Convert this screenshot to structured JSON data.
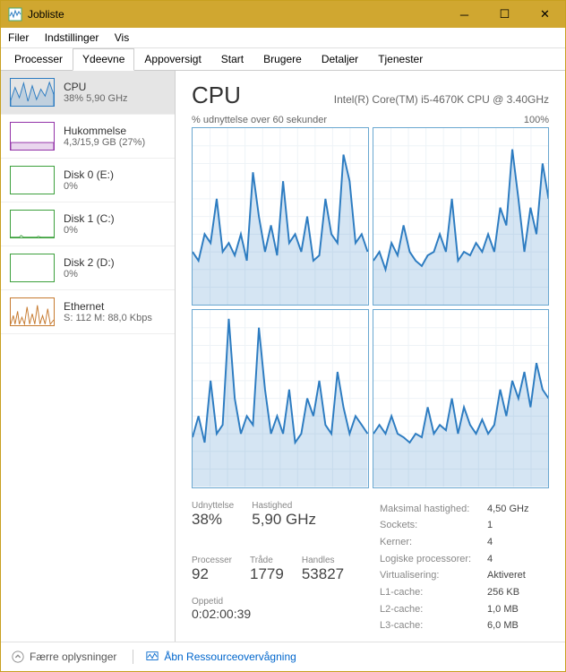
{
  "window": {
    "title": "Jobliste"
  },
  "menu": {
    "file": "Filer",
    "settings": "Indstillinger",
    "view": "Vis"
  },
  "tabs": [
    "Processer",
    "Ydeevne",
    "Appoversigt",
    "Start",
    "Brugere",
    "Detaljer",
    "Tjenester"
  ],
  "activeTab": 1,
  "sidebar": [
    {
      "name": "CPU",
      "sub": "38%  5,90 GHz",
      "color": "#2d7cc1"
    },
    {
      "name": "Hukommelse",
      "sub": "4,3/15,9 GB (27%)",
      "color": "#9333a8"
    },
    {
      "name": "Disk 0 (E:)",
      "sub": "0%",
      "color": "#3ca03c"
    },
    {
      "name": "Disk 1 (C:)",
      "sub": "0%",
      "color": "#3ca03c"
    },
    {
      "name": "Disk 2 (D:)",
      "sub": "0%",
      "color": "#3ca03c"
    },
    {
      "name": "Ethernet",
      "sub": "S: 112 M: 88,0 Kbps",
      "color": "#c67a2f"
    }
  ],
  "selectedSidebar": 0,
  "main": {
    "title": "CPU",
    "model": "Intel(R) Core(TM) i5-4670K CPU @ 3.40GHz",
    "chartLabelLeft": "% udnyttelse over 60 sekunder",
    "chartLabelRight": "100%"
  },
  "stats": {
    "utilLabel": "Udnyttelse",
    "util": "38%",
    "speedLabel": "Hastighed",
    "speed": "5,90 GHz",
    "procLabel": "Processer",
    "proc": "92",
    "threadsLabel": "Tråde",
    "threads": "1779",
    "handlesLabel": "Handles",
    "handles": "53827",
    "uptimeLabel": "Oppetid",
    "uptime": "0:02:00:39"
  },
  "right": [
    {
      "k": "Maksimal hastighed:",
      "v": "4,50 GHz"
    },
    {
      "k": "Sockets:",
      "v": "1"
    },
    {
      "k": "Kerner:",
      "v": "4"
    },
    {
      "k": "Logiske processorer:",
      "v": "4"
    },
    {
      "k": "Virtualisering:",
      "v": "Aktiveret"
    },
    {
      "k": "L1-cache:",
      "v": "256 KB"
    },
    {
      "k": "L2-cache:",
      "v": "1,0 MB"
    },
    {
      "k": "L3-cache:",
      "v": "6,0 MB"
    }
  ],
  "footer": {
    "fewer": "Færre oplysninger",
    "resmon": "Åbn Ressourceovervågning"
  },
  "chart_data": {
    "type": "line",
    "cores": 4,
    "x_seconds": 60,
    "ylim": [
      0,
      100
    ],
    "title": "% udnyttelse over 60 sekunder",
    "series": [
      {
        "name": "Core 0",
        "values": [
          30,
          25,
          40,
          35,
          60,
          30,
          35,
          28,
          40,
          25,
          75,
          50,
          30,
          45,
          28,
          70,
          35,
          40,
          30,
          50,
          25,
          28,
          60,
          40,
          35,
          85,
          70,
          35,
          40,
          30
        ]
      },
      {
        "name": "Core 1",
        "values": [
          25,
          30,
          20,
          35,
          28,
          45,
          30,
          25,
          22,
          28,
          30,
          40,
          30,
          60,
          25,
          30,
          28,
          35,
          30,
          40,
          30,
          55,
          45,
          88,
          60,
          30,
          55,
          40,
          80,
          60
        ]
      },
      {
        "name": "Core 2",
        "values": [
          28,
          40,
          25,
          60,
          30,
          35,
          95,
          50,
          30,
          40,
          35,
          90,
          55,
          30,
          40,
          30,
          55,
          25,
          30,
          50,
          40,
          60,
          35,
          30,
          65,
          45,
          30,
          40,
          35,
          30
        ]
      },
      {
        "name": "Core 3",
        "values": [
          30,
          35,
          30,
          40,
          30,
          28,
          25,
          30,
          28,
          45,
          30,
          35,
          32,
          50,
          30,
          45,
          35,
          30,
          38,
          30,
          35,
          55,
          40,
          60,
          50,
          65,
          45,
          70,
          55,
          50
        ]
      }
    ]
  }
}
